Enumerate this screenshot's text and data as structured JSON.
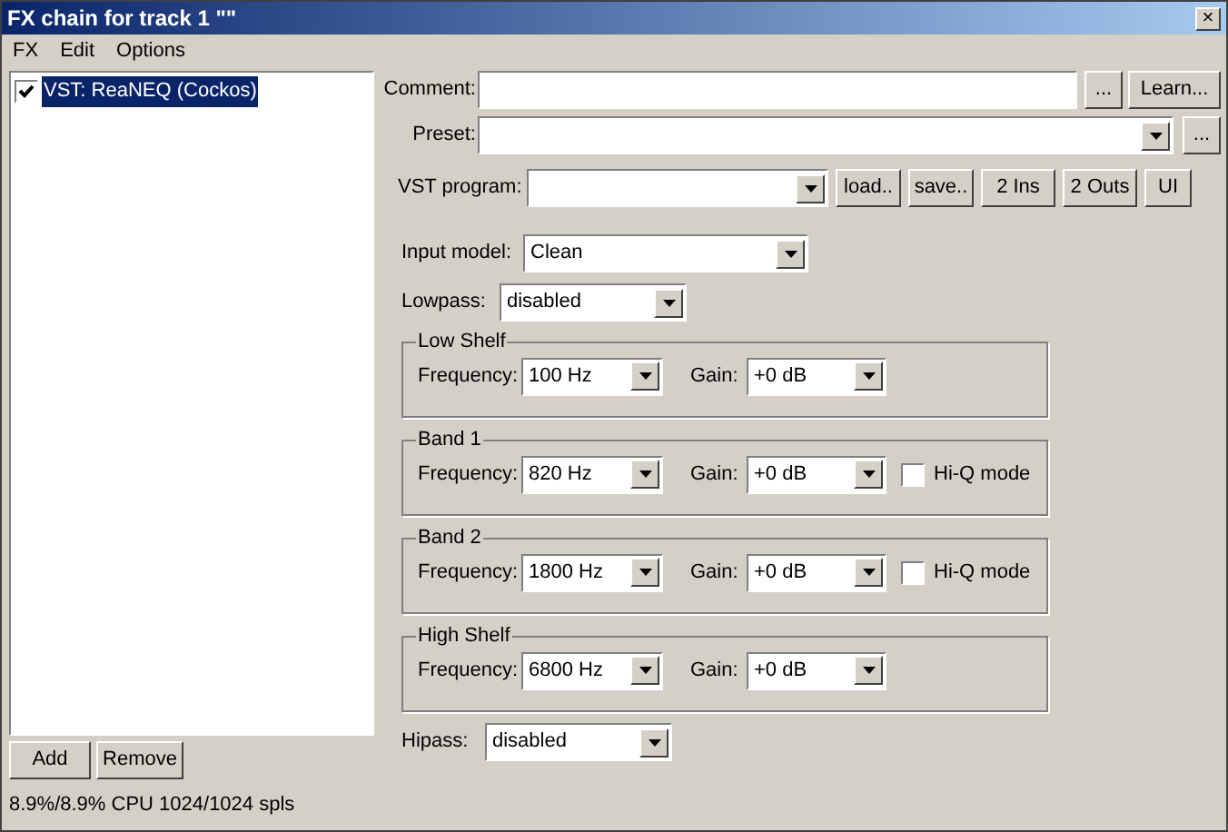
{
  "window": {
    "title": "FX chain for track 1 \"\"",
    "close": "×"
  },
  "menu": [
    "FX",
    "Edit",
    "Options"
  ],
  "fx_list": [
    {
      "label": "VST: ReaNEQ (Cockos)",
      "checked": true,
      "selected": true
    }
  ],
  "list_buttons": [
    "Add",
    "Remove"
  ],
  "status": "8.9%/8.9% CPU 1024/1024 spls",
  "comment": {
    "label": "Comment:",
    "buttons": [
      "...",
      "Learn..."
    ]
  },
  "preset": {
    "label": "Preset:",
    "button": "..."
  },
  "vst_program": {
    "label": "VST program:",
    "buttons": [
      "load..",
      "save..",
      "2 Ins",
      "2 Outs",
      "UI"
    ]
  },
  "input_model": {
    "label": "Input model:",
    "value": "Clean"
  },
  "lowpass": {
    "label": "Lowpass:",
    "value": "disabled"
  },
  "bands": [
    {
      "title": "Low Shelf",
      "frequency_label": "Frequency:",
      "frequency": "100 Hz",
      "gain_label": "Gain:",
      "gain": "+0 dB"
    },
    {
      "title": "Band 1",
      "frequency_label": "Frequency:",
      "frequency": "820 Hz",
      "gain_label": "Gain:",
      "gain": "+0 dB",
      "hiq": {
        "label": "Hi-Q mode",
        "checked": false
      }
    },
    {
      "title": "Band 2",
      "frequency_label": "Frequency:",
      "frequency": "1800 Hz",
      "gain_label": "Gain:",
      "gain": "+0 dB",
      "hiq": {
        "label": "Hi-Q mode",
        "checked": false
      }
    },
    {
      "title": "High Shelf",
      "frequency_label": "Frequency:",
      "frequency": "6800 Hz",
      "gain_label": "Gain:",
      "gain": "+0 dB"
    }
  ],
  "hipass": {
    "label": "Hipass:",
    "value": "disabled"
  }
}
